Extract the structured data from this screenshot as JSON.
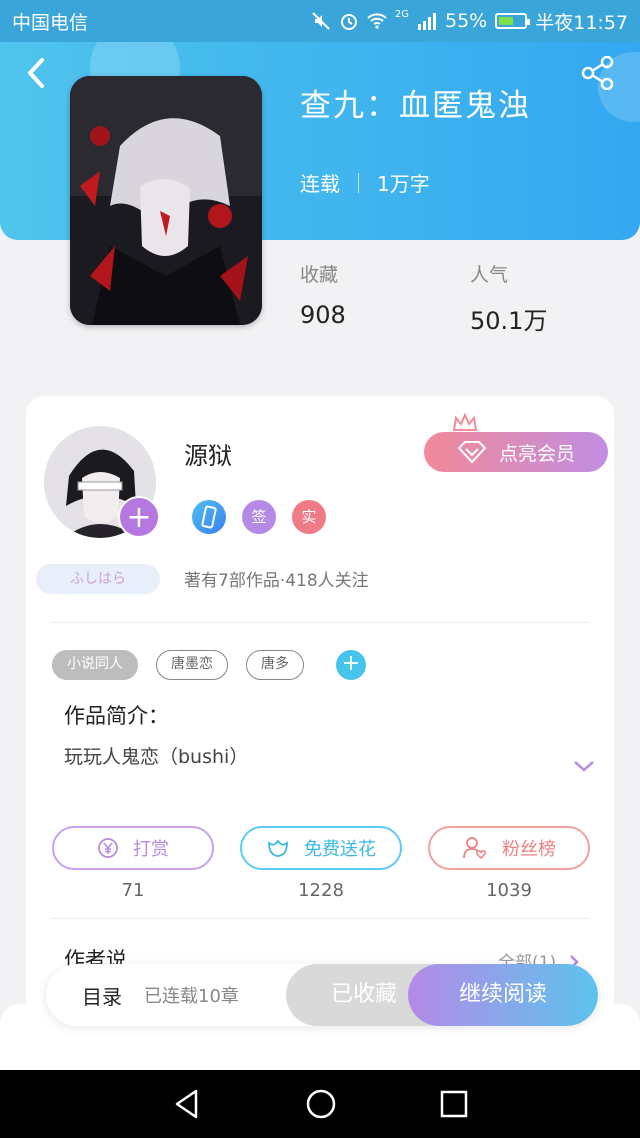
{
  "status_bar": {
    "carrier": "中国电信",
    "network": "2G",
    "battery": "55%",
    "time": "半夜11:57"
  },
  "header": {
    "title": "查九：血匿鬼浊",
    "status": "连载",
    "word_count": "1万字",
    "back_icon": "chevron-left-icon",
    "share_icon": "share-icon"
  },
  "stats": {
    "favorites_label": "收藏",
    "favorites_value": "908",
    "popularity_label": "人气",
    "popularity_value": "50.1万"
  },
  "author": {
    "name": "源狱",
    "badge_sign": "签",
    "badge_real": "实",
    "decoration_text": "ふしはら",
    "info": "著有7部作品·418人关注",
    "vip_label": "点亮会员"
  },
  "tags": [
    "小说同人",
    "唐墨恋",
    "唐多"
  ],
  "intro": {
    "label": "作品简介：",
    "text": "玩玩人鬼恋（bushi）"
  },
  "actions": [
    {
      "label": "打赏",
      "count": "71",
      "color": "#b88ae0"
    },
    {
      "label": "免费送花",
      "count": "1228",
      "color": "#47c4ec"
    },
    {
      "label": "粉丝榜",
      "count": "1039",
      "color": "#f08c8c"
    }
  ],
  "author_say": {
    "label": "作者说",
    "all_link": "全部(1)"
  },
  "bottom_bar": {
    "toc": "目录",
    "chapters": "已连载10章",
    "collected": "已收藏",
    "continue": "继续阅读"
  },
  "colors": {
    "header_start": "#4fc4ec",
    "header_end": "#33a8f0",
    "vip_start": "#f28a98",
    "vip_end": "#c08ee2"
  }
}
